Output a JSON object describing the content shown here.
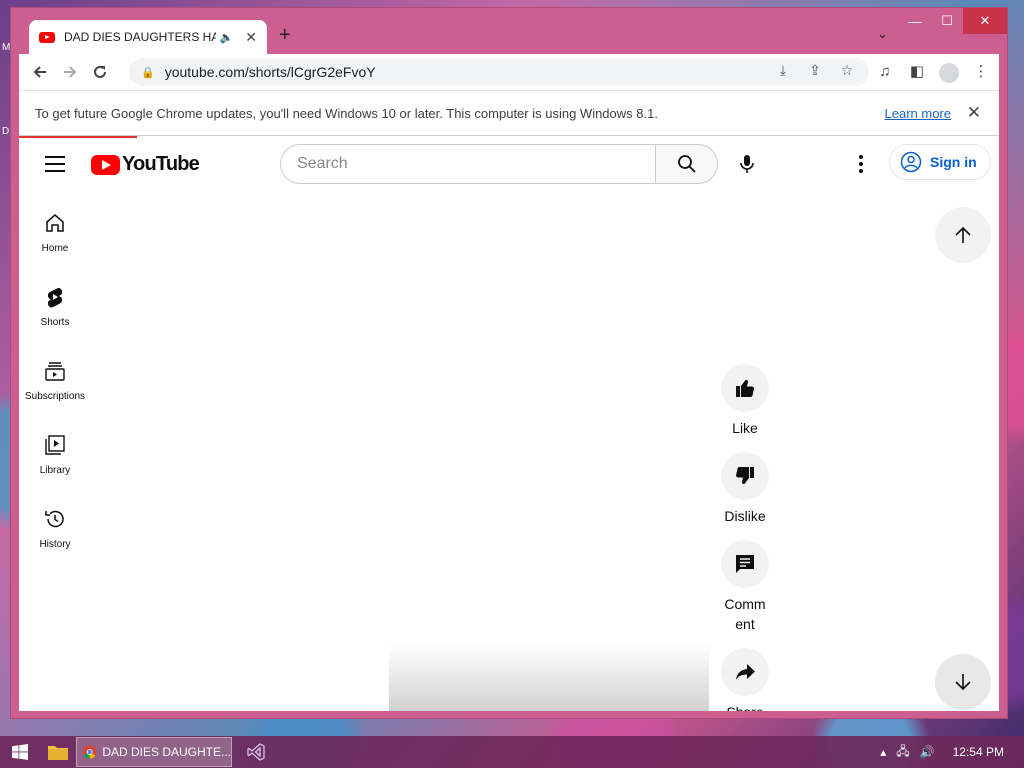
{
  "desktop": {
    "left_labels": [
      "M",
      "D"
    ]
  },
  "browser": {
    "tab": {
      "title": "DAD DIES DAUGHTERS HAIR",
      "audio_icon": "speaker-icon",
      "close": "✕"
    },
    "new_tab": "+",
    "window_controls": {
      "minimize": "—",
      "maximize": "☐",
      "close": "✕"
    },
    "address": {
      "url": "youtube.com/shorts/lCgrG2eFvoY"
    }
  },
  "infobar": {
    "message": "To get future Google Chrome updates, you'll need Windows 10 or later. This computer is using Windows 8.1.",
    "link": "Learn more",
    "close": "✕"
  },
  "youtube": {
    "logo_text": "YouTube",
    "search": {
      "placeholder": "Search"
    },
    "signin_label": "Sign in",
    "guide": [
      {
        "label": "Home",
        "icon": "home-icon"
      },
      {
        "label": "Shorts",
        "icon": "shorts-icon"
      },
      {
        "label": "Subscriptions",
        "icon": "subscriptions-icon"
      },
      {
        "label": "Library",
        "icon": "library-icon"
      },
      {
        "label": "History",
        "icon": "history-icon"
      }
    ],
    "actions": [
      {
        "label": "Like",
        "icon": "thumbs-up-icon"
      },
      {
        "label": "Dislike",
        "icon": "thumbs-down-icon"
      },
      {
        "label": "Comm\nent",
        "icon": "comment-icon"
      },
      {
        "label": "Share",
        "icon": "share-icon"
      }
    ]
  },
  "taskbar": {
    "chrome_task_label": "DAD DIES DAUGHTE...",
    "clock": "12:54 PM"
  }
}
